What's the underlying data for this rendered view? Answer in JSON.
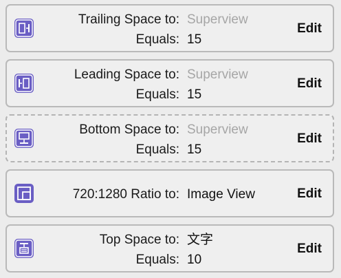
{
  "constraints": [
    {
      "icon": "trailing-space-icon",
      "relation_label": "Trailing Space to:",
      "target": "Superview",
      "target_muted": true,
      "equals_label": "Equals:",
      "constant": "15",
      "edit_label": "Edit",
      "dashed": false
    },
    {
      "icon": "leading-space-icon",
      "relation_label": "Leading Space to:",
      "target": "Superview",
      "target_muted": true,
      "equals_label": "Equals:",
      "constant": "15",
      "edit_label": "Edit",
      "dashed": false
    },
    {
      "icon": "bottom-space-icon",
      "relation_label": "Bottom Space to:",
      "target": "Superview",
      "target_muted": true,
      "equals_label": "Equals:",
      "constant": "15",
      "edit_label": "Edit",
      "dashed": true
    },
    {
      "icon": "aspect-ratio-icon",
      "relation_label": "720:1280 Ratio to:",
      "target": "Image View",
      "target_muted": false,
      "edit_label": "Edit",
      "dashed": false
    },
    {
      "icon": "top-space-icon",
      "relation_label": "Top Space to:",
      "target": "文字",
      "target_muted": false,
      "equals_label": "Equals:",
      "constant": "10",
      "edit_label": "Edit",
      "dashed": false
    }
  ],
  "colors": {
    "icon_fill": "#6a5ec4",
    "icon_glyph": "#ffffff",
    "muted_text": "#a6a6a6",
    "card_border": "#b9b9b9"
  }
}
